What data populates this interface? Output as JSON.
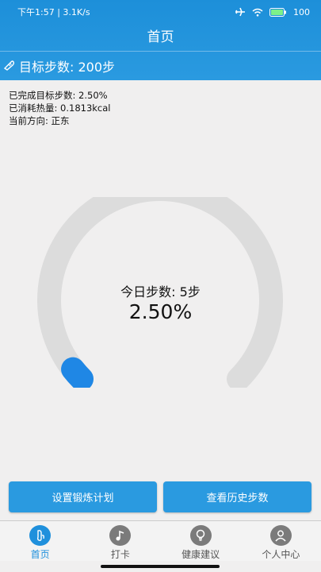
{
  "status_bar": {
    "time_speed": "下午1:57 | 3.1K/s",
    "battery": "100"
  },
  "header": {
    "title": "首页"
  },
  "goal": {
    "label": "目标步数: 200步"
  },
  "info": {
    "completed": "已完成目标步数: 2.50%",
    "calories": "已消耗热量: 0.1813kcal",
    "direction": "当前方向: 正东"
  },
  "gauge": {
    "steps_label": "今日步数: 5步",
    "percent_label": "2.50%",
    "progress": 0.025
  },
  "buttons": {
    "plan": "设置锻炼计划",
    "history": "查看历史步数"
  },
  "tabs": [
    {
      "label": "首页",
      "icon": "shoe-icon"
    },
    {
      "label": "打卡",
      "icon": "music-note-icon"
    },
    {
      "label": "健康建议",
      "icon": "lightbulb-icon"
    },
    {
      "label": "个人中心",
      "icon": "person-icon"
    }
  ],
  "colors": {
    "primary": "#2a9ae0",
    "track": "#dcdcdc",
    "background": "#f0efef"
  }
}
